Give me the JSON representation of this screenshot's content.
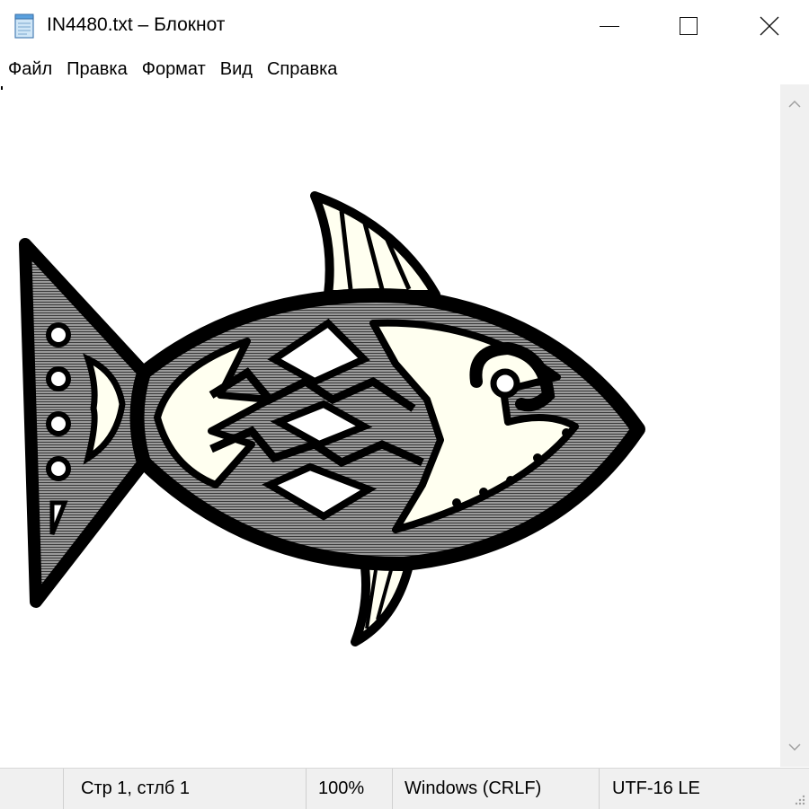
{
  "window": {
    "title": "IN4480.txt – Блокнот",
    "app_icon": "notepad-icon",
    "controls": {
      "minimize_icon": "minimize-icon",
      "maximize_icon": "maximize-icon",
      "close_icon": "close-icon"
    }
  },
  "menu": {
    "items": [
      {
        "label": "Файл"
      },
      {
        "label": "Правка"
      },
      {
        "label": "Формат"
      },
      {
        "label": "Вид"
      },
      {
        "label": "Справка"
      }
    ]
  },
  "editor": {
    "content_image": "fish-illustration",
    "colors": {
      "outline": "#000000",
      "body_gray": "#8c8c8c",
      "cream": "#fffff0"
    }
  },
  "scrollbar": {
    "up_icon": "scroll-up-arrow-icon",
    "down_icon": "scroll-down-arrow-icon"
  },
  "status": {
    "position": "Стр 1, стлб 1",
    "zoom": "100%",
    "line_endings": "Windows (CRLF)",
    "encoding": "UTF-16 LE"
  }
}
